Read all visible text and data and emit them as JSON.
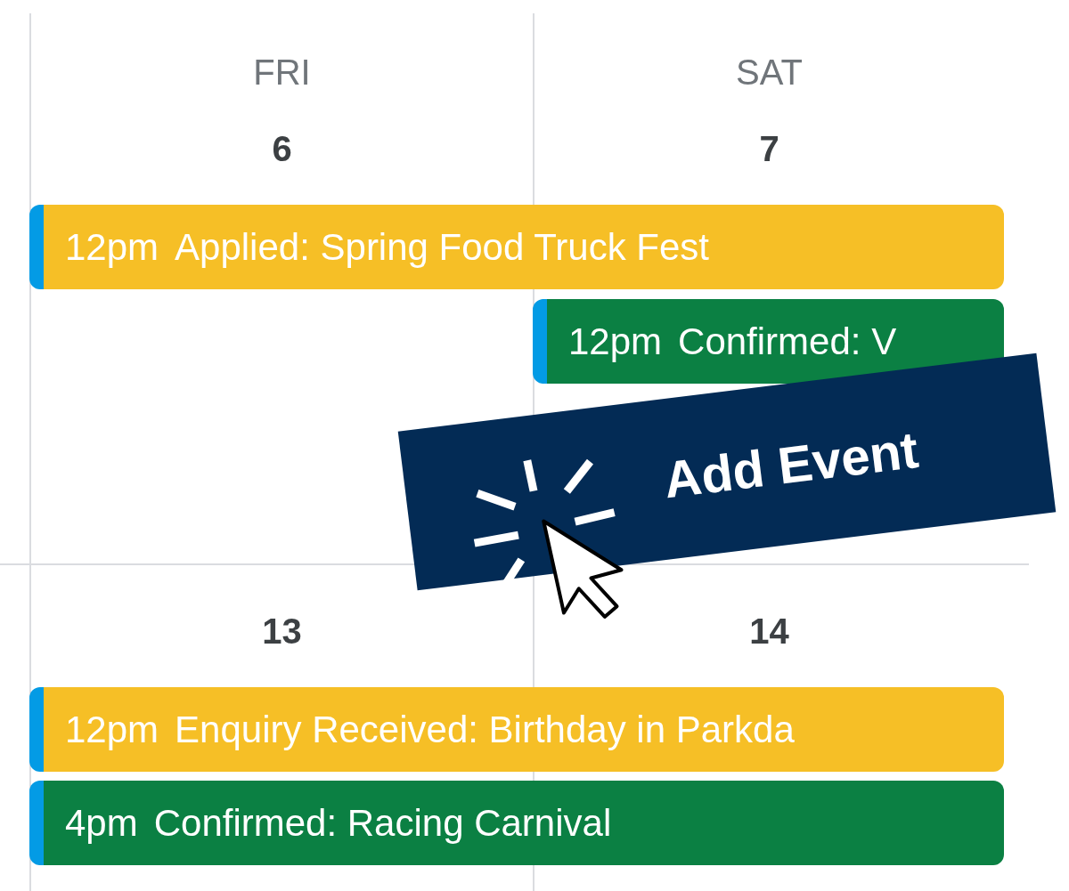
{
  "weeks": [
    {
      "days": [
        {
          "name": "FRI",
          "number": "6"
        },
        {
          "name": "SAT",
          "number": "7"
        }
      ],
      "events": [
        {
          "time": "12pm",
          "title": "Applied: Spring Food Truck Fest",
          "color": "#f6bf26",
          "kind": "span"
        },
        {
          "time": "12pm",
          "title": "Confirmed: V",
          "color": "#0b8043",
          "kind": "second"
        }
      ]
    },
    {
      "days": [
        {
          "number": "13"
        },
        {
          "number": "14"
        }
      ],
      "events": [
        {
          "time": "12pm",
          "title": "Enquiry Received: Birthday in Parkda",
          "color": "#f6bf26",
          "kind": "span"
        },
        {
          "time": "4pm",
          "title": "Confirmed: Racing Carnival",
          "color": "#0b8043",
          "kind": "span"
        }
      ]
    }
  ],
  "overlay": {
    "label": "Add Event"
  }
}
